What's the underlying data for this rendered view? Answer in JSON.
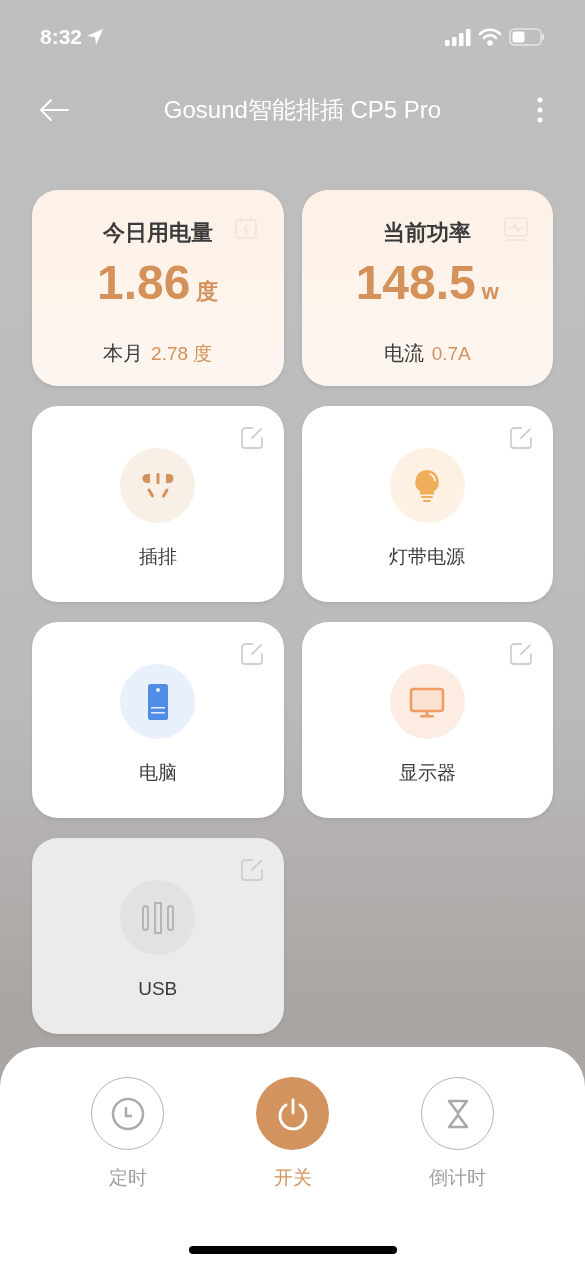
{
  "status_bar": {
    "time": "8:32"
  },
  "header": {
    "title": "Gosund智能排插 CP5 Pro"
  },
  "stats": [
    {
      "kind": "energy",
      "title": "今日用电量",
      "value": "1.86",
      "unit": "度",
      "sub_label": "本月",
      "sub_value": "2.78 度"
    },
    {
      "kind": "power",
      "title": "当前功率",
      "value": "148.5",
      "unit": "w",
      "sub_label": "电流",
      "sub_value": "0.7A"
    }
  ],
  "outlets": [
    {
      "name": "插排",
      "kind": "plug",
      "on": true
    },
    {
      "name": "灯带电源",
      "kind": "bulb",
      "on": true
    },
    {
      "name": "电脑",
      "kind": "pc",
      "on": true
    },
    {
      "name": "显示器",
      "kind": "monitor",
      "on": true
    },
    {
      "name": "USB",
      "kind": "usb",
      "on": false
    }
  ],
  "actions": [
    {
      "label": "定时",
      "kind": "schedule",
      "selected": false
    },
    {
      "label": "开关",
      "kind": "power",
      "selected": true
    },
    {
      "label": "倒计时",
      "kind": "countdown",
      "selected": false
    }
  ]
}
